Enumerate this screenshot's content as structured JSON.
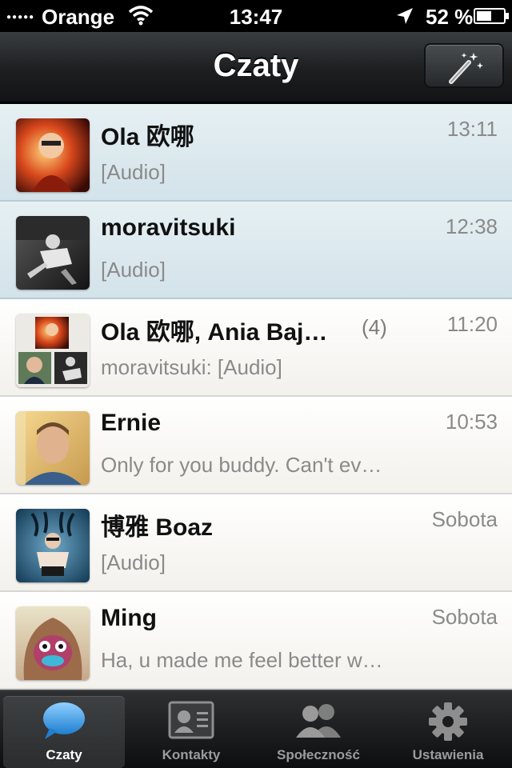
{
  "status_bar": {
    "signal": "●●●●●",
    "carrier": "Orange",
    "time": "13:47",
    "battery": "52 %"
  },
  "nav": {
    "title": "Czaty"
  },
  "chats": [
    {
      "name": "Ola 欧哪",
      "time": "13:11",
      "preview": "[Audio]",
      "unread": true,
      "count": ""
    },
    {
      "name": "moravitsuki",
      "time": "12:38",
      "preview": "[Audio]",
      "unread": true,
      "count": ""
    },
    {
      "name": "Ola 欧哪, Ania Baj…",
      "time": "11:20",
      "preview": "moravitsuki: [Audio]",
      "unread": false,
      "count": "(4)"
    },
    {
      "name": "Ernie",
      "time": "10:53",
      "preview": "Only for you buddy. Can't ev…",
      "unread": false,
      "count": ""
    },
    {
      "name": "博雅 Boaz",
      "time": "Sobota",
      "preview": "[Audio]",
      "unread": false,
      "count": ""
    },
    {
      "name": "Ming",
      "time": "Sobota",
      "preview": "Ha, u made me feel better w…",
      "unread": false,
      "count": ""
    }
  ],
  "tabs": [
    {
      "label": "Czaty",
      "icon": "speech-bubble-icon",
      "active": true
    },
    {
      "label": "Kontakty",
      "icon": "contact-card-icon",
      "active": false
    },
    {
      "label": "Społeczność",
      "icon": "people-icon",
      "active": false
    },
    {
      "label": "Ustawienia",
      "icon": "gear-icon",
      "active": false
    }
  ],
  "colors": {
    "unread_row": "#d9e8ee",
    "read_row": "#f7f6f2",
    "tab_active_icon": "#3aa0e8"
  }
}
